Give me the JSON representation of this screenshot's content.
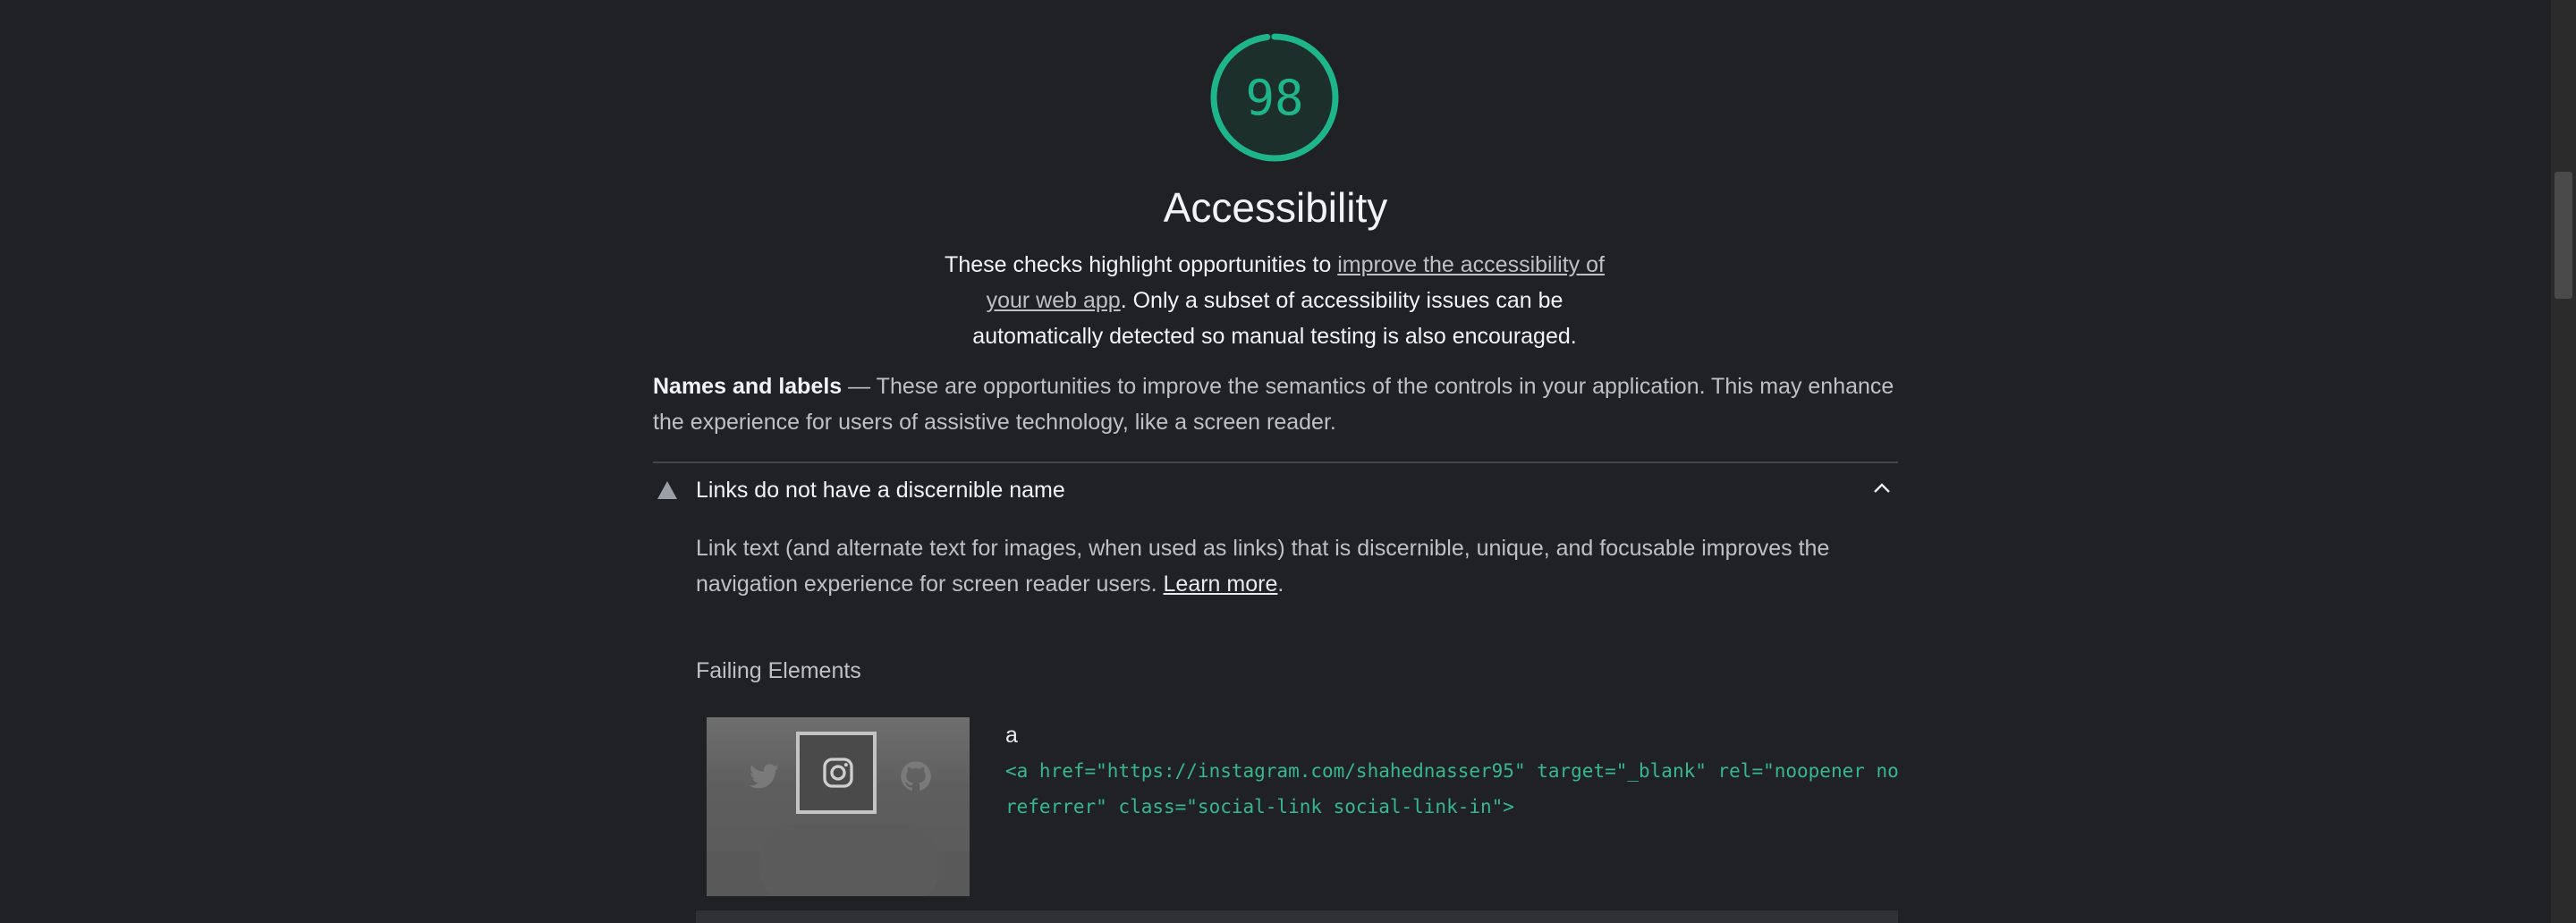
{
  "gauge": {
    "score": "98",
    "color": "#1fb58b",
    "fraction": 0.98
  },
  "category": {
    "title": "Accessibility",
    "desc_before": "These checks highlight opportunities to ",
    "desc_link": "improve the accessibility of your web app",
    "desc_after": ". Only a subset of accessibility issues can be automatically detected so manual testing is also encouraged."
  },
  "group": {
    "title": "Names and labels",
    "separator": " — ",
    "description": "These are opportunities to improve the semantics of the controls in your application. This may enhance the experience for users of assistive technology, like a screen reader."
  },
  "audit": {
    "title": "Links do not have a discernible name",
    "warning_icon": "triangle-warning-icon",
    "toggle_icon": "chevron-up-icon",
    "desc_before": "Link text (and alternate text for images, when used as links) that is discernible, unique, and focusable improves the navigation experience for screen reader users. ",
    "desc_link": "Learn more",
    "desc_after": ".",
    "failing_label": "Failing Elements",
    "node": {
      "label": "a",
      "snippet": "<a href=\"https://instagram.com/shahednasser95\" target=\"_blank\" rel=\"noopener noreferrer\" class=\"social-link social-link-in\">"
    },
    "thumb_icons": [
      "twitter-icon",
      "instagram-icon",
      "github-icon"
    ]
  },
  "colors": {
    "background": "#202124",
    "pass": "#1fb58b",
    "text": "#e8eaed",
    "muted": "#bdc1c6"
  }
}
